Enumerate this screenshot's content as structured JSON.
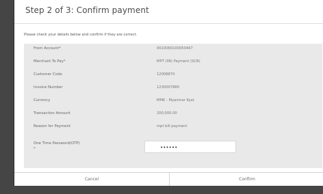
{
  "dialog": {
    "title": "Step 2 of 3: Confirm payment",
    "instruction": "Please check your details below and confirm if they are correct.",
    "rows": [
      {
        "label": "From Account*",
        "value": "0010060100050467"
      },
      {
        "label": "Merchant To Pay*",
        "value": "MPT (08) Payment (SCB)"
      },
      {
        "label": "Customer Code",
        "value": "12008870"
      },
      {
        "label": "Invoice Number",
        "value": "1230007880"
      },
      {
        "label": "Currency",
        "value": "MMK - Myanmar Kyat"
      },
      {
        "label": "Transaction Amount",
        "value": "200,000.00"
      },
      {
        "label": "Reason for Payment",
        "value": "mpt bill payment"
      }
    ],
    "otp": {
      "label": "One Time Password(OTP) *",
      "value": "••••••"
    },
    "buttons": {
      "cancel": "Cancel",
      "confirm": "Confirm"
    }
  },
  "colors": {
    "dialog_background": "#ffffff",
    "details_background": "#e9e9e9",
    "frame_background": "#454545"
  }
}
